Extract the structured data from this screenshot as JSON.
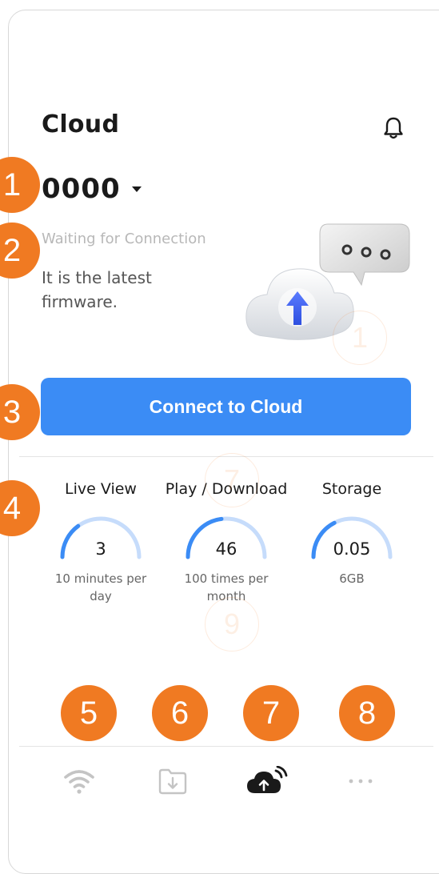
{
  "header": {
    "title": "Cloud",
    "bell_icon": "bell-icon"
  },
  "device": {
    "name": "0000",
    "caret_icon": "caret-down-icon"
  },
  "status": {
    "connection": "Waiting for Connection",
    "firmware": "It is the latest firmware."
  },
  "illustration_icon": "cloud-upload-chat-illustration",
  "actions": {
    "connect_label": "Connect to Cloud"
  },
  "usage": [
    {
      "label": "Live View",
      "value": "3",
      "limit": "10 minutes per day",
      "fraction": 0.3
    },
    {
      "label": "Play / Download",
      "value": "46",
      "limit": "100 times per month",
      "fraction": 0.46
    },
    {
      "label": "Storage",
      "value": "0.05",
      "limit": "6GB",
      "fraction": 0.35
    }
  ],
  "tabs": [
    {
      "name": "wifi-tab",
      "icon": "wifi-icon",
      "active": false
    },
    {
      "name": "download-tab",
      "icon": "folder-download-icon",
      "active": false
    },
    {
      "name": "cloud-tab",
      "icon": "cloud-upload-icon",
      "active": true
    },
    {
      "name": "more-tab",
      "icon": "more-dots-icon",
      "active": false
    }
  ],
  "annotations": [
    "1",
    "2",
    "3",
    "4",
    "5",
    "6",
    "7",
    "8"
  ],
  "ghost_annotations": [
    "1",
    "7",
    "9"
  ],
  "colors": {
    "accent": "#3b8cf5",
    "marker": "#f07a22",
    "gauge_track": "#c6dcfb"
  }
}
